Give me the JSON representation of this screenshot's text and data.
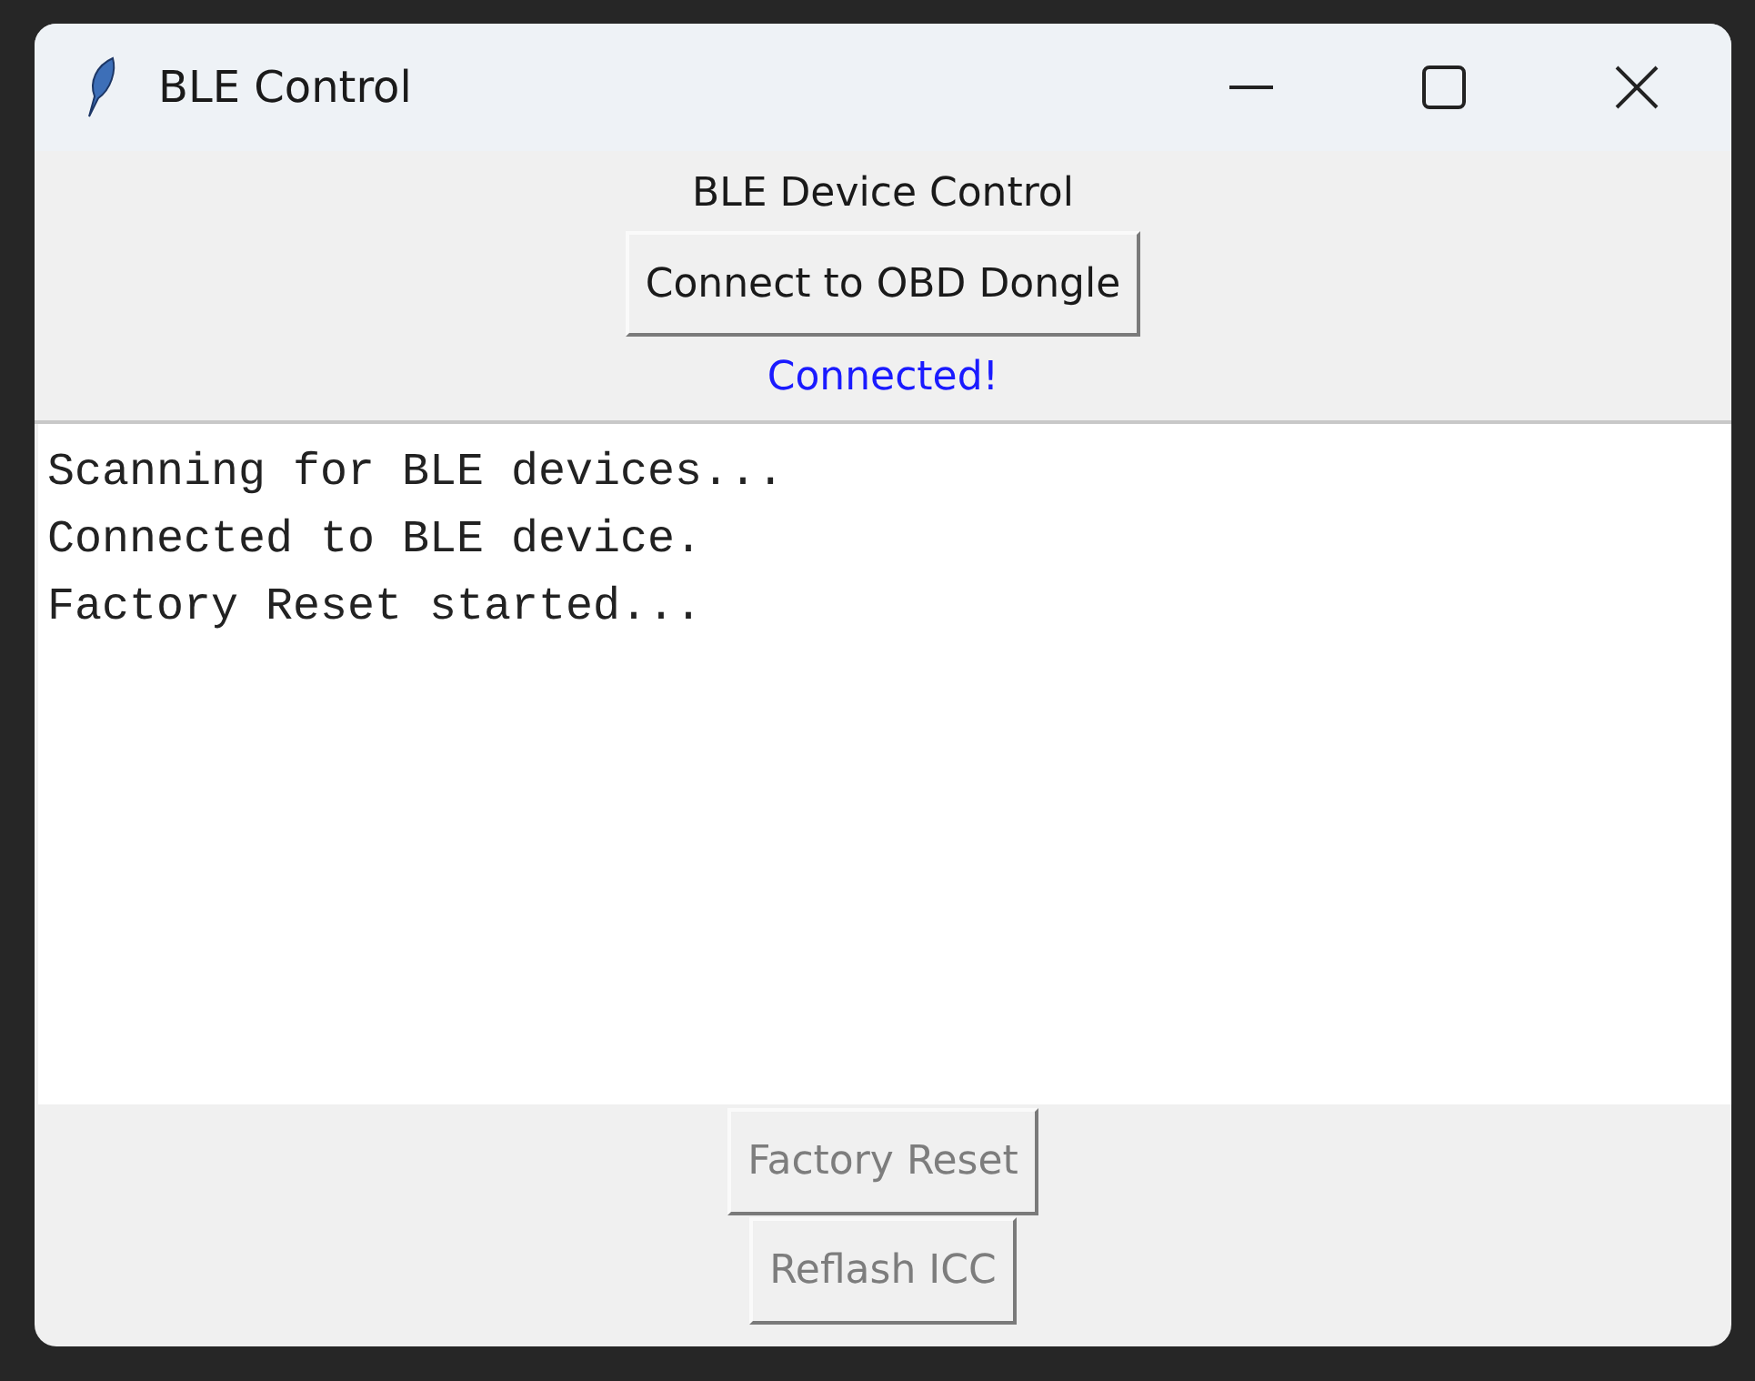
{
  "window": {
    "title": "BLE Control"
  },
  "heading": "BLE Device Control",
  "connect_button": {
    "label": "Connect to OBD Dongle",
    "disabled": false
  },
  "status": {
    "text": "Connected!",
    "color": "#1a1aff"
  },
  "log": [
    "Scanning for BLE devices...",
    "Connected to BLE device.",
    "Factory Reset started..."
  ],
  "buttons": [
    {
      "label": "Factory Reset",
      "disabled": true
    },
    {
      "label": "Reflash ICC",
      "disabled": true
    }
  ]
}
